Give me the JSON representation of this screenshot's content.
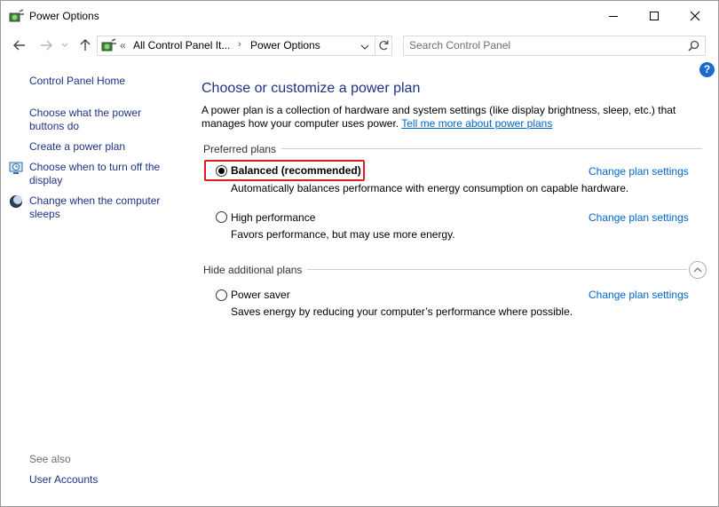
{
  "window": {
    "title": "Power Options"
  },
  "nav": {
    "breadcrumb_prefix": "«",
    "breadcrumb_root": "All Control Panel It...",
    "breadcrumb_sep": "›",
    "breadcrumb_current": "Power Options",
    "search_placeholder": "Search Control Panel"
  },
  "help": {
    "glyph": "?"
  },
  "sidebar": {
    "home": "Control Panel Home",
    "items": [
      {
        "label_line1": "Choose what the power",
        "label_line2": "buttons do"
      },
      {
        "label_line1": "Create a power plan"
      },
      {
        "label_line1": "Choose when to turn off the",
        "label_line2": "display",
        "icon": "display-schedule-icon"
      },
      {
        "label_line1": "Change when the computer",
        "label_line2": "sleeps",
        "icon": "moon-icon"
      }
    ],
    "see_also": "See also",
    "user_accounts": "User Accounts"
  },
  "main": {
    "heading": "Choose or customize a power plan",
    "description": "A power plan is a collection of hardware and system settings (like display brightness, sleep, etc.) that manages how your computer uses power.",
    "learn_more": "Tell me more about power plans",
    "preferred_label": "Preferred plans",
    "additional_label": "Hide additional plans",
    "change_link": "Change plan settings",
    "plans": [
      {
        "name": "Balanced (recommended)",
        "description": "Automatically balances performance with energy consumption on capable hardware.",
        "selected": true
      },
      {
        "name": "High performance",
        "description": "Favors performance, but may use more energy.",
        "selected": false
      },
      {
        "name": "Power saver",
        "description": "Saves energy by reducing your computer’s performance where possible.",
        "selected": false
      }
    ]
  },
  "colors": {
    "link": "#0066cc",
    "heading": "#1e3287",
    "highlight": "#e0191d"
  }
}
